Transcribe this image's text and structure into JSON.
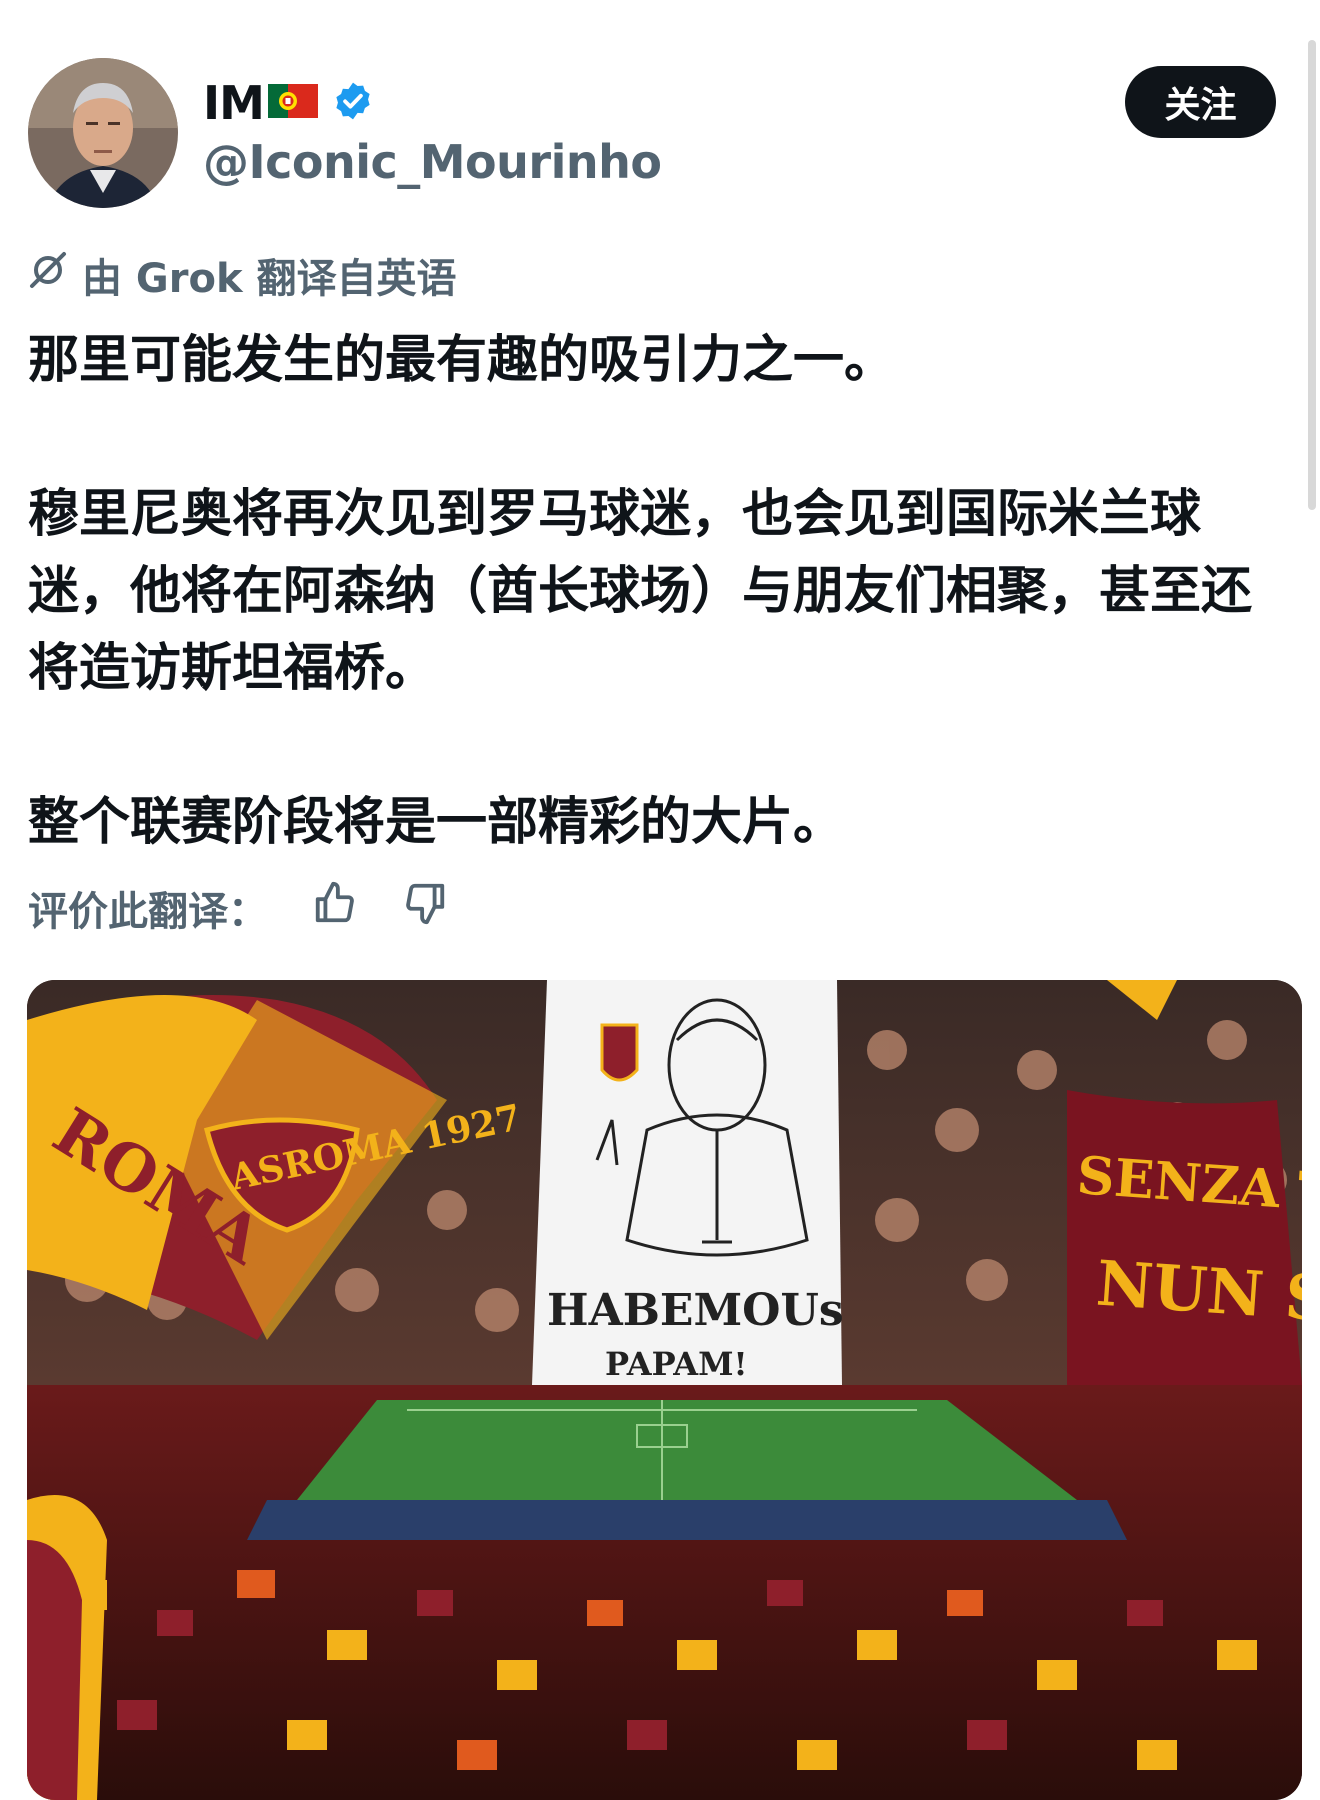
{
  "author": {
    "display_name": "IM",
    "flag_icon": "portugal-flag-icon",
    "verified_icon": "verified-badge-icon",
    "handle": "@Iconic_Mourinho"
  },
  "follow_button": {
    "label": "关注"
  },
  "translation": {
    "icon": "grok-icon",
    "label": "由 Grok 翻译自英语"
  },
  "tweet": {
    "paragraphs": [
      "那里可能发生的最有趣的吸引力之一。",
      "穆里尼奥将再次见到罗马球迷，也会见到国际米兰球迷，他将在阿森纳（酋长球场）与朋友们相聚，甚至还将造访斯坦福桥。",
      "整个联赛阶段将是一部精彩的大片。"
    ]
  },
  "rating": {
    "label": "评价此翻译：",
    "thumbs_up_icon": "thumbs-up-icon",
    "thumbs_down_icon": "thumbs-down-icon"
  },
  "media": {
    "flag_text": "ROMA",
    "badge_text": "ASROMA 1927",
    "banner_left_line1": "HABEMOUs",
    "banner_left_line2": "PAPAM!",
    "banner_right_line1": "SENZA TE",
    "banner_right_line2": "NUN SO",
    "colors": {
      "roma_red": "#8e1f2b",
      "roma_yellow": "#f3b21a",
      "pitch": "#3c8b3a"
    }
  }
}
